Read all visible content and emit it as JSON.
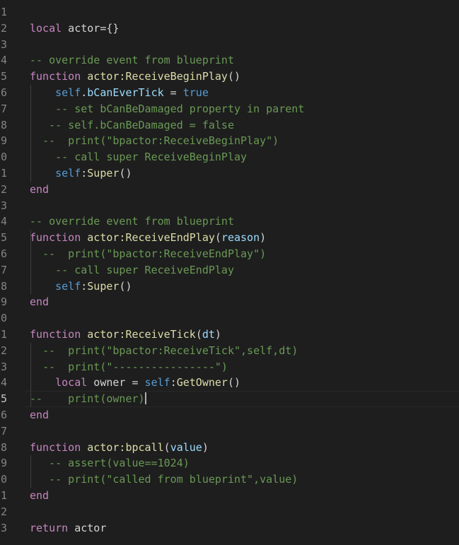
{
  "editor": {
    "active_line": 25,
    "theme_colors": {
      "background": "#1e1e1e",
      "keyword": "#c586c0",
      "builtin": "#569cd6",
      "function": "#dcdcaa",
      "identifier": "#9cdcfe",
      "comment": "#6a9955",
      "text": "#d4d4d4",
      "line_number": "#858585"
    },
    "lines": [
      {
        "n": "1",
        "tokens": []
      },
      {
        "n": "2",
        "tokens": [
          {
            "t": "kw",
            "v": "local"
          },
          {
            "t": "tx",
            "v": " actor={}"
          }
        ]
      },
      {
        "n": "3",
        "tokens": []
      },
      {
        "n": "4",
        "tokens": [
          {
            "t": "cm",
            "v": "-- override event from blueprint"
          }
        ]
      },
      {
        "n": "5",
        "tokens": [
          {
            "t": "kw",
            "v": "function"
          },
          {
            "t": "tx",
            "v": " "
          },
          {
            "t": "fn",
            "v": "actor:ReceiveBeginPlay"
          },
          {
            "t": "tx",
            "v": "()"
          }
        ]
      },
      {
        "n": "6",
        "tokens": [
          {
            "t": "tx",
            "v": "    "
          },
          {
            "t": "kw2",
            "v": "self"
          },
          {
            "t": "tx",
            "v": "."
          },
          {
            "t": "id",
            "v": "bCanEverTick"
          },
          {
            "t": "tx",
            "v": " = "
          },
          {
            "t": "kw2",
            "v": "true"
          }
        ]
      },
      {
        "n": "7",
        "tokens": [
          {
            "t": "tx",
            "v": "    "
          },
          {
            "t": "cm",
            "v": "-- set bCanBeDamaged property in parent"
          }
        ]
      },
      {
        "n": "8",
        "tokens": [
          {
            "t": "tx",
            "v": "   "
          },
          {
            "t": "cm",
            "v": "-- self.bCanBeDamaged = false"
          }
        ]
      },
      {
        "n": "9",
        "tokens": [
          {
            "t": "tx",
            "v": "  "
          },
          {
            "t": "cm",
            "v": "--  print(\"bpactor:ReceiveBeginPlay\")"
          }
        ]
      },
      {
        "n": "0",
        "tokens": [
          {
            "t": "tx",
            "v": "    "
          },
          {
            "t": "cm",
            "v": "-- call super ReceiveBeginPlay"
          }
        ]
      },
      {
        "n": "1",
        "tokens": [
          {
            "t": "tx",
            "v": "    "
          },
          {
            "t": "kw2",
            "v": "self"
          },
          {
            "t": "tx",
            "v": ":"
          },
          {
            "t": "fn",
            "v": "Super"
          },
          {
            "t": "tx",
            "v": "()"
          }
        ]
      },
      {
        "n": "2",
        "tokens": [
          {
            "t": "kw",
            "v": "end"
          }
        ]
      },
      {
        "n": "3",
        "tokens": []
      },
      {
        "n": "4",
        "tokens": [
          {
            "t": "cm",
            "v": "-- override event from blueprint"
          }
        ]
      },
      {
        "n": "5",
        "tokens": [
          {
            "t": "kw",
            "v": "function"
          },
          {
            "t": "tx",
            "v": " "
          },
          {
            "t": "fn",
            "v": "actor:ReceiveEndPlay"
          },
          {
            "t": "tx",
            "v": "("
          },
          {
            "t": "id",
            "v": "reason"
          },
          {
            "t": "tx",
            "v": ")"
          }
        ]
      },
      {
        "n": "6",
        "tokens": [
          {
            "t": "tx",
            "v": "  "
          },
          {
            "t": "cm",
            "v": "--  print(\"bpactor:ReceiveEndPlay\")"
          }
        ]
      },
      {
        "n": "7",
        "tokens": [
          {
            "t": "tx",
            "v": "    "
          },
          {
            "t": "cm",
            "v": "-- call super ReceiveEndPlay"
          }
        ]
      },
      {
        "n": "8",
        "tokens": [
          {
            "t": "tx",
            "v": "    "
          },
          {
            "t": "kw2",
            "v": "self"
          },
          {
            "t": "tx",
            "v": ":"
          },
          {
            "t": "fn",
            "v": "Super"
          },
          {
            "t": "tx",
            "v": "()"
          }
        ]
      },
      {
        "n": "9",
        "tokens": [
          {
            "t": "kw",
            "v": "end"
          }
        ]
      },
      {
        "n": "0",
        "tokens": []
      },
      {
        "n": "1",
        "tokens": [
          {
            "t": "kw",
            "v": "function"
          },
          {
            "t": "tx",
            "v": " "
          },
          {
            "t": "fn",
            "v": "actor:ReceiveTick"
          },
          {
            "t": "tx",
            "v": "("
          },
          {
            "t": "id",
            "v": "dt"
          },
          {
            "t": "tx",
            "v": ")"
          }
        ]
      },
      {
        "n": "2",
        "tokens": [
          {
            "t": "tx",
            "v": "  "
          },
          {
            "t": "cm",
            "v": "--  print(\"bpactor:ReceiveTick\",self,dt)"
          }
        ]
      },
      {
        "n": "3",
        "tokens": [
          {
            "t": "tx",
            "v": "  "
          },
          {
            "t": "cm",
            "v": "--  print(\"----------------\")"
          }
        ]
      },
      {
        "n": "4",
        "tokens": [
          {
            "t": "tx",
            "v": "    "
          },
          {
            "t": "kw",
            "v": "local"
          },
          {
            "t": "tx",
            "v": " owner = "
          },
          {
            "t": "kw2",
            "v": "self"
          },
          {
            "t": "tx",
            "v": ":"
          },
          {
            "t": "fn",
            "v": "GetOwner"
          },
          {
            "t": "tx",
            "v": "()"
          }
        ]
      },
      {
        "n": "5",
        "tokens": [
          {
            "t": "cm",
            "v": "--    print(owner)"
          }
        ],
        "caret": true
      },
      {
        "n": "6",
        "tokens": [
          {
            "t": "kw",
            "v": "end"
          }
        ]
      },
      {
        "n": "7",
        "tokens": []
      },
      {
        "n": "8",
        "tokens": [
          {
            "t": "kw",
            "v": "function"
          },
          {
            "t": "tx",
            "v": " "
          },
          {
            "t": "fn",
            "v": "actor:bpcall"
          },
          {
            "t": "tx",
            "v": "("
          },
          {
            "t": "id",
            "v": "value"
          },
          {
            "t": "tx",
            "v": ")"
          }
        ]
      },
      {
        "n": "9",
        "tokens": [
          {
            "t": "tx",
            "v": "   "
          },
          {
            "t": "cm",
            "v": "-- assert(value==1024)"
          }
        ]
      },
      {
        "n": "0",
        "tokens": [
          {
            "t": "tx",
            "v": "   "
          },
          {
            "t": "cm",
            "v": "-- print(\"called from blueprint\",value)"
          }
        ]
      },
      {
        "n": "1",
        "tokens": [
          {
            "t": "kw",
            "v": "end"
          }
        ]
      },
      {
        "n": "2",
        "tokens": []
      },
      {
        "n": "3",
        "tokens": [
          {
            "t": "kw",
            "v": "return"
          },
          {
            "t": "tx",
            "v": " actor"
          }
        ]
      }
    ]
  }
}
